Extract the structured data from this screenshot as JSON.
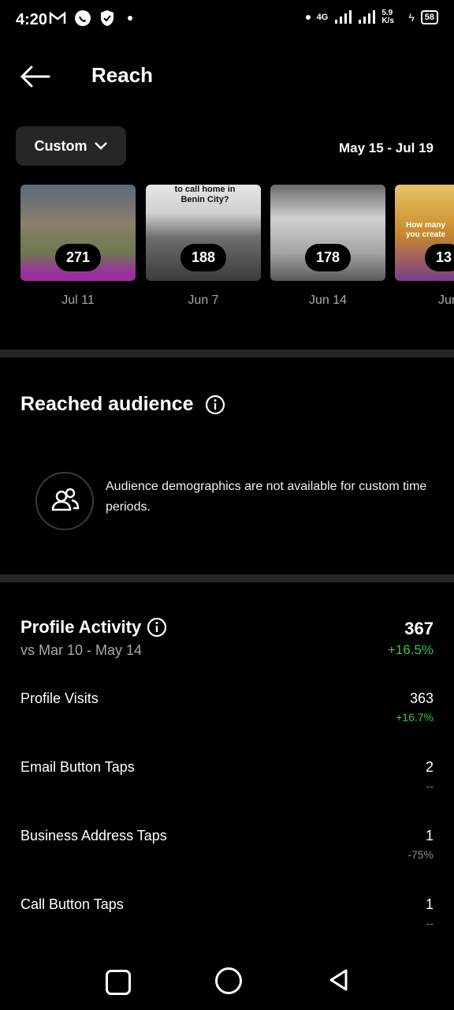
{
  "status": {
    "time": "4:20",
    "network": "4G",
    "speed": "5.9 K/s",
    "battery": "58"
  },
  "header": {
    "title": "Reach"
  },
  "filter": {
    "label": "Custom",
    "date_range": "May 15 - Jul 19"
  },
  "thumbnails": [
    {
      "count": "271",
      "date": "Jul 11"
    },
    {
      "count": "188",
      "date": "Jun 7",
      "caption": "to call home in Benin City?"
    },
    {
      "count": "178",
      "date": "Jun 14"
    },
    {
      "count": "13",
      "date": "Jun",
      "caption": "How many you create"
    }
  ],
  "reached_audience": {
    "title": "Reached audience",
    "message": "Audience demographics are not available for custom time periods."
  },
  "profile_activity": {
    "title": "Profile Activity",
    "comparison": "vs Mar 10 - May 14",
    "total": "367",
    "total_delta": "+16.5%",
    "rows": [
      {
        "label": "Profile Visits",
        "value": "363",
        "delta": "+16.7%"
      },
      {
        "label": "Email Button Taps",
        "value": "2",
        "delta": "--"
      },
      {
        "label": "Business Address Taps",
        "value": "1",
        "delta": "-75%"
      },
      {
        "label": "Call Button Taps",
        "value": "1",
        "delta": "--"
      }
    ]
  },
  "colors": {
    "positive": "#2ecc40",
    "muted": "#a8a8a8",
    "panel": "#262626"
  }
}
